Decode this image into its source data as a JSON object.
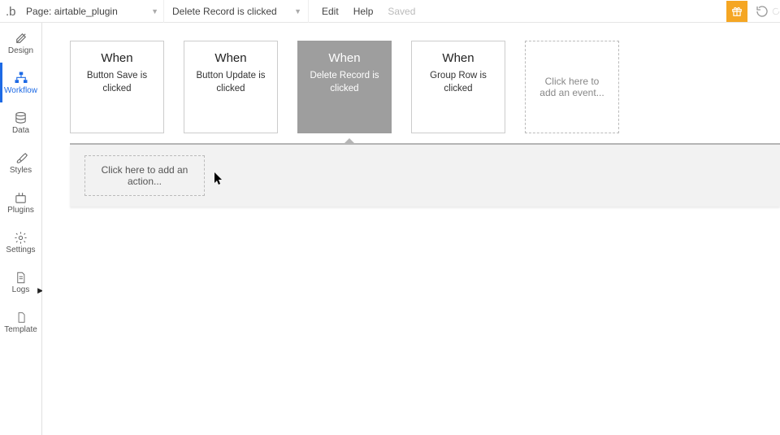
{
  "topbar": {
    "page_label": "Page: airtable_plugin",
    "event_selector": "Delete Record is clicked",
    "edit": "Edit",
    "help": "Help",
    "saved": "Saved"
  },
  "sidebar": {
    "items": [
      {
        "label": "Design"
      },
      {
        "label": "Workflow"
      },
      {
        "label": "Data"
      },
      {
        "label": "Styles"
      },
      {
        "label": "Plugins"
      },
      {
        "label": "Settings"
      },
      {
        "label": "Logs"
      },
      {
        "label": "Template"
      }
    ]
  },
  "events": [
    {
      "when": "When",
      "desc": "Button Save is clicked"
    },
    {
      "when": "When",
      "desc": "Button Update is clicked"
    },
    {
      "when": "When",
      "desc": "Delete Record is clicked"
    },
    {
      "when": "When",
      "desc": "Group Row is clicked"
    }
  ],
  "add_event": "Click here to add an event...",
  "add_action": "Click here to add an action..."
}
